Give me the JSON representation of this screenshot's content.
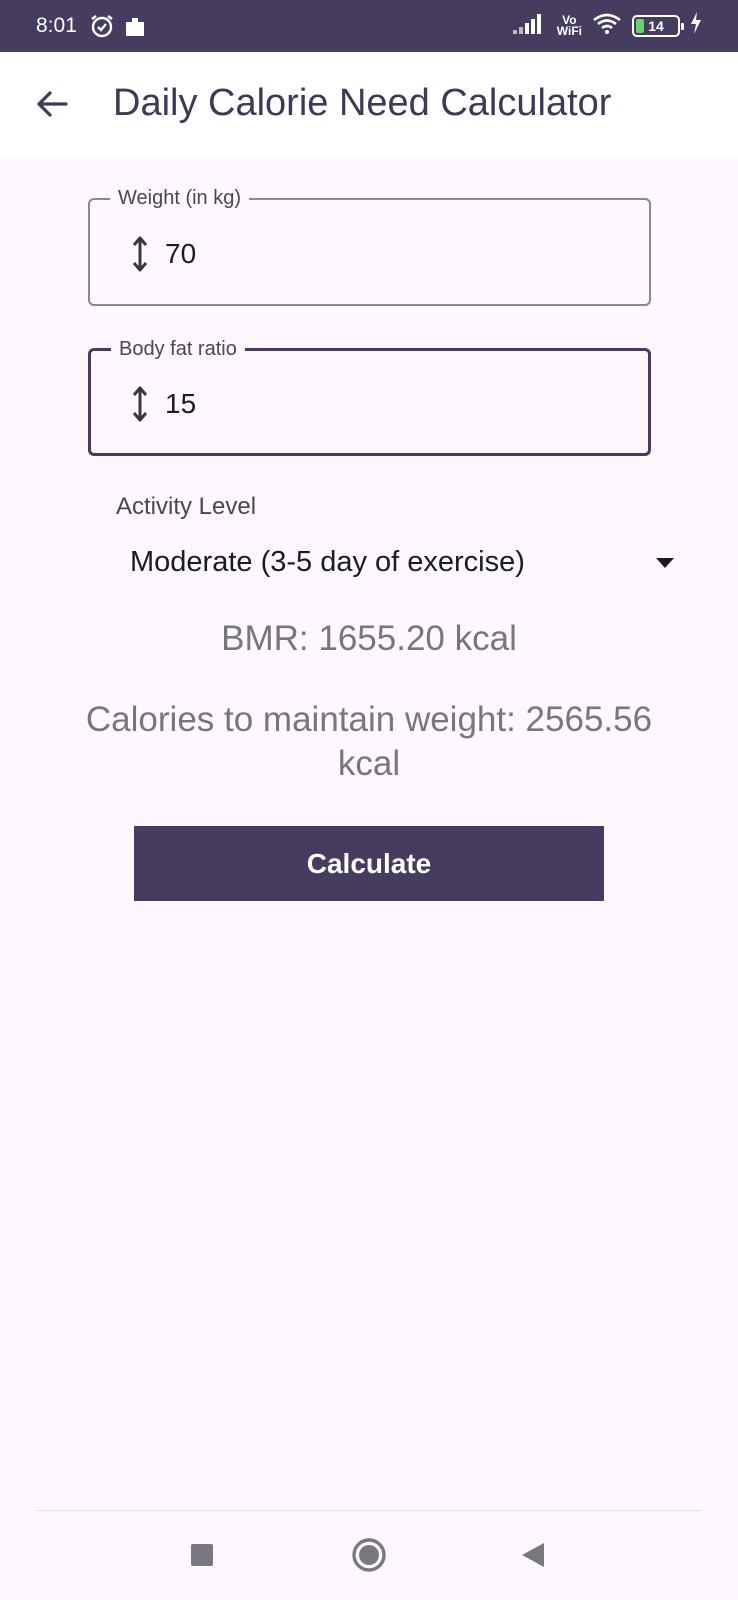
{
  "status_bar": {
    "time": "8:01",
    "network_label_top": "Vo",
    "network_label_bottom": "WiFi",
    "battery_level": "14"
  },
  "app_bar": {
    "title": "Daily Calorie Need Calculator"
  },
  "form": {
    "weight": {
      "label": "Weight (in kg)",
      "value": "70"
    },
    "body_fat": {
      "label": "Body fat ratio",
      "value": "15"
    },
    "activity": {
      "label": "Activity Level",
      "selected": "Moderate (3-5 day of exercise)"
    }
  },
  "results": {
    "bmr": "BMR: 1655.20 kcal",
    "maintain": "Calories to maintain weight: 2565.56 kcal"
  },
  "actions": {
    "calculate_label": "Calculate"
  },
  "colors": {
    "primary": "#463c60",
    "background": "#fdf8fd",
    "result_text": "#797580"
  },
  "icons": [
    "alarm-icon",
    "app-notification-icon",
    "signal-icon",
    "wifi-icon",
    "battery-icon",
    "charging-icon",
    "back-arrow-icon",
    "vertical-arrows-icon",
    "dropdown-arrow-icon",
    "nav-recents-icon",
    "nav-home-icon",
    "nav-back-icon"
  ]
}
